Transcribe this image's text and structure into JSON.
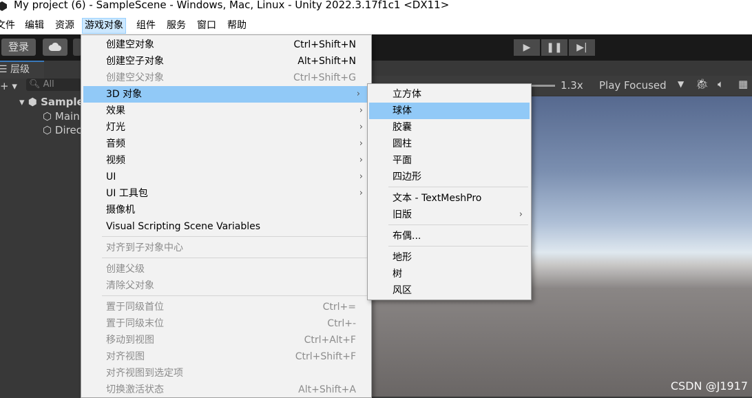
{
  "window": {
    "title": "My project (6) - SampleScene - Windows, Mac, Linux - Unity 2022.3.17f1c1 <DX11>"
  },
  "menubar": {
    "items": [
      "文件",
      "编辑",
      "资源",
      "游戏对象",
      "组件",
      "服务",
      "窗口",
      "帮助"
    ]
  },
  "toolbar": {
    "login": "登录",
    "cloud_icon": "cloud-icon",
    "play_icon": "▶",
    "pause_icon": "❚❚",
    "step_icon": "▶|"
  },
  "hierarchy": {
    "tab_label": "层级",
    "add_label": "+ ▾",
    "search_placeholder": "All",
    "scene_label": "Sample",
    "children": [
      "Main",
      "Direc"
    ]
  },
  "scene_view": {
    "scale_value": "1.3x",
    "play_mode": "Play Focused"
  },
  "gameobject_menu": {
    "items": [
      {
        "label": "创建空对象",
        "shortcut": "Ctrl+Shift+N",
        "disabled": false
      },
      {
        "label": "创建空子对象",
        "shortcut": "Alt+Shift+N",
        "disabled": false
      },
      {
        "label": "创建空父对象",
        "shortcut": "Ctrl+Shift+G",
        "disabled": true
      },
      {
        "label": "3D 对象",
        "shortcut": "",
        "arrow": true,
        "highlighted": true
      },
      {
        "label": "效果",
        "arrow": true
      },
      {
        "label": "灯光",
        "arrow": true
      },
      {
        "label": "音频",
        "arrow": true
      },
      {
        "label": "视频",
        "arrow": true
      },
      {
        "label": "UI",
        "arrow": true
      },
      {
        "label": "UI 工具包",
        "arrow": true
      },
      {
        "label": "摄像机"
      },
      {
        "label": "Visual Scripting Scene Variables"
      },
      {
        "label": "对齐到子对象中心",
        "disabled": true
      },
      {
        "label": "创建父级",
        "disabled": true
      },
      {
        "label": "清除父对象",
        "disabled": true
      },
      {
        "label": "置于同级首位",
        "shortcut": "Ctrl+=",
        "disabled": true
      },
      {
        "label": "置于同级末位",
        "shortcut": "Ctrl+-",
        "disabled": true
      },
      {
        "label": "移动到视图",
        "shortcut": "Ctrl+Alt+F",
        "disabled": true
      },
      {
        "label": "对齐视图",
        "shortcut": "Ctrl+Shift+F",
        "disabled": true
      },
      {
        "label": "对齐视图到选定项",
        "disabled": true
      },
      {
        "label": "切换激活状态",
        "shortcut": "Alt+Shift+A",
        "disabled": true
      }
    ]
  },
  "submenu_3d": {
    "items": [
      {
        "label": "立方体"
      },
      {
        "label": "球体",
        "highlighted": true
      },
      {
        "label": "胶囊"
      },
      {
        "label": "圆柱"
      },
      {
        "label": "平面"
      },
      {
        "label": "四边形"
      },
      {
        "label": "文本 - TextMeshPro"
      },
      {
        "label": "旧版",
        "arrow": true
      },
      {
        "label": "布偶..."
      },
      {
        "label": "地形"
      },
      {
        "label": "树"
      },
      {
        "label": "风区"
      }
    ]
  },
  "watermark": "CSDN @J1917"
}
